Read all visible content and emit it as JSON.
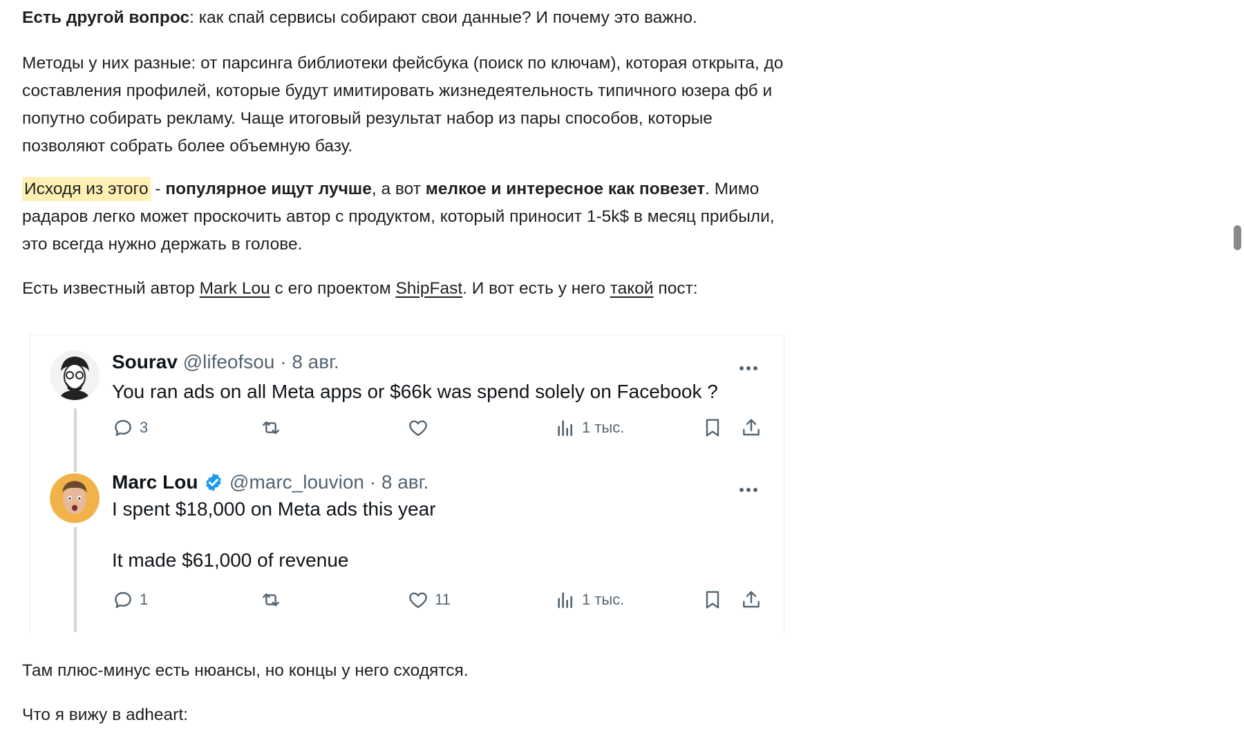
{
  "article": {
    "p1": {
      "bold": "Есть другой вопрос",
      "rest": ": как спай сервисы собирают свои данные? И почему это важно."
    },
    "p2": "Методы у них разные: от парсинга библиотеки фейсбука (поиск по ключам), которая открыта, до составления профилей, которые будут имитировать жизнедеятельность типичного юзера фб и попутно собирать рекламу. Чаще итоговый результат набор из пары способов, которые позволяют собрать более объемную базу.",
    "p3": {
      "highlight": "Исходя из этого",
      "sep": " - ",
      "bold1": "популярное ищут лучше",
      "mid": ", а вот ",
      "bold2": "мелкое и интересное как повезет",
      "rest": ". Мимо радаров легко может проскочить автор с продуктом, который приносит 1-5k$ в месяц прибыли, это всегда нужно держать в голове."
    },
    "p4": {
      "t1": "Есть известный автор ",
      "link1": "Mark Lou",
      "t2": " с его проектом ",
      "link2": "ShipFast",
      "t3": ". И вот есть у него ",
      "link3": "такой",
      "t4": " пост:"
    },
    "p5": "Там плюс-минус есть нюансы, но концы у него сходятся.",
    "p6": "Что я вижу в adheart:"
  },
  "tweets": [
    {
      "name": "Sourav",
      "handle": "@lifeofsou",
      "date": "· 8 авг.",
      "text": "You ran ads on all Meta apps or $66k was spend solely on Facebook ?",
      "replies": "3",
      "retweets": "",
      "likes": "",
      "views": "1 тыс.",
      "verified": false
    },
    {
      "name": "Marc Lou",
      "handle": "@marc_louvion",
      "date": "· 8 авг.",
      "text": "I spent $18,000 on Meta ads this year\n\nIt made $61,000 of revenue",
      "replies": "1",
      "retweets": "",
      "likes": "11",
      "views": "1 тыс.",
      "verified": true
    }
  ],
  "colors": {
    "highlight": "#fdf0b4",
    "verified": "#1d9bf0",
    "muted": "#536471"
  }
}
